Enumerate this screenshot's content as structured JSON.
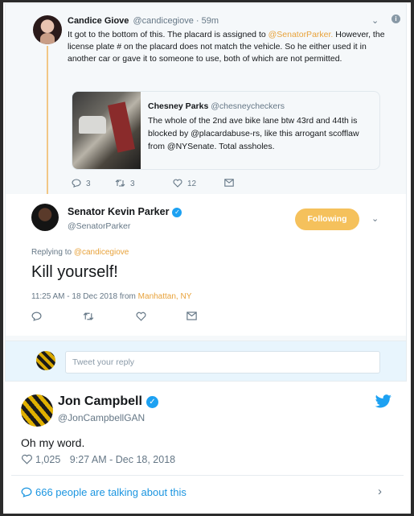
{
  "reply_tweet": {
    "name": "Candice Giove",
    "handle": "@candicegiove · 59m",
    "text_before": "It got to the bottom of this. The placard  is assigned to ",
    "mention": "@SenatorParker.",
    "text_after": " However, the license plate # on the placard does not match the vehicle. So he either used it in another car or gave it to someone to use, both of which are not permitted.",
    "caret_icon": "chevron-down-icon",
    "info_icon": "i",
    "quote": {
      "name": "Chesney Parks",
      "handle": "@chesneycheckers",
      "text": "The whole of the 2nd ave bike lane btw 43rd and 44th is blocked by @placardabuse-rs, like this arrogant scofflaw from @NYSenate. Total assholes."
    },
    "actions": {
      "reply_count": "3",
      "retweet_count": "3",
      "like_count": "12"
    }
  },
  "main_tweet": {
    "name": "Senator Kevin Parker",
    "handle": "@SenatorParker",
    "follow_label": "Following",
    "replying_prefix": "Replying to ",
    "replying_mention": "@candicegiove",
    "text": "Kill yourself!",
    "time": "11:25 AM - 18 Dec 2018 from ",
    "location": "Manhattan, NY"
  },
  "composer": {
    "placeholder": "Tweet your reply"
  },
  "embed": {
    "name": "Jon Campbell",
    "handle": "@JonCampbellGAN",
    "text": "Oh my word.",
    "likes": "1,025",
    "time": "9:27 AM - Dec 18, 2018",
    "talking": "666 people are talking about this"
  },
  "colors": {
    "accent_yellow": "#f5c15c",
    "twitter_blue": "#1da1f2",
    "thread_line": "#f1c786"
  }
}
